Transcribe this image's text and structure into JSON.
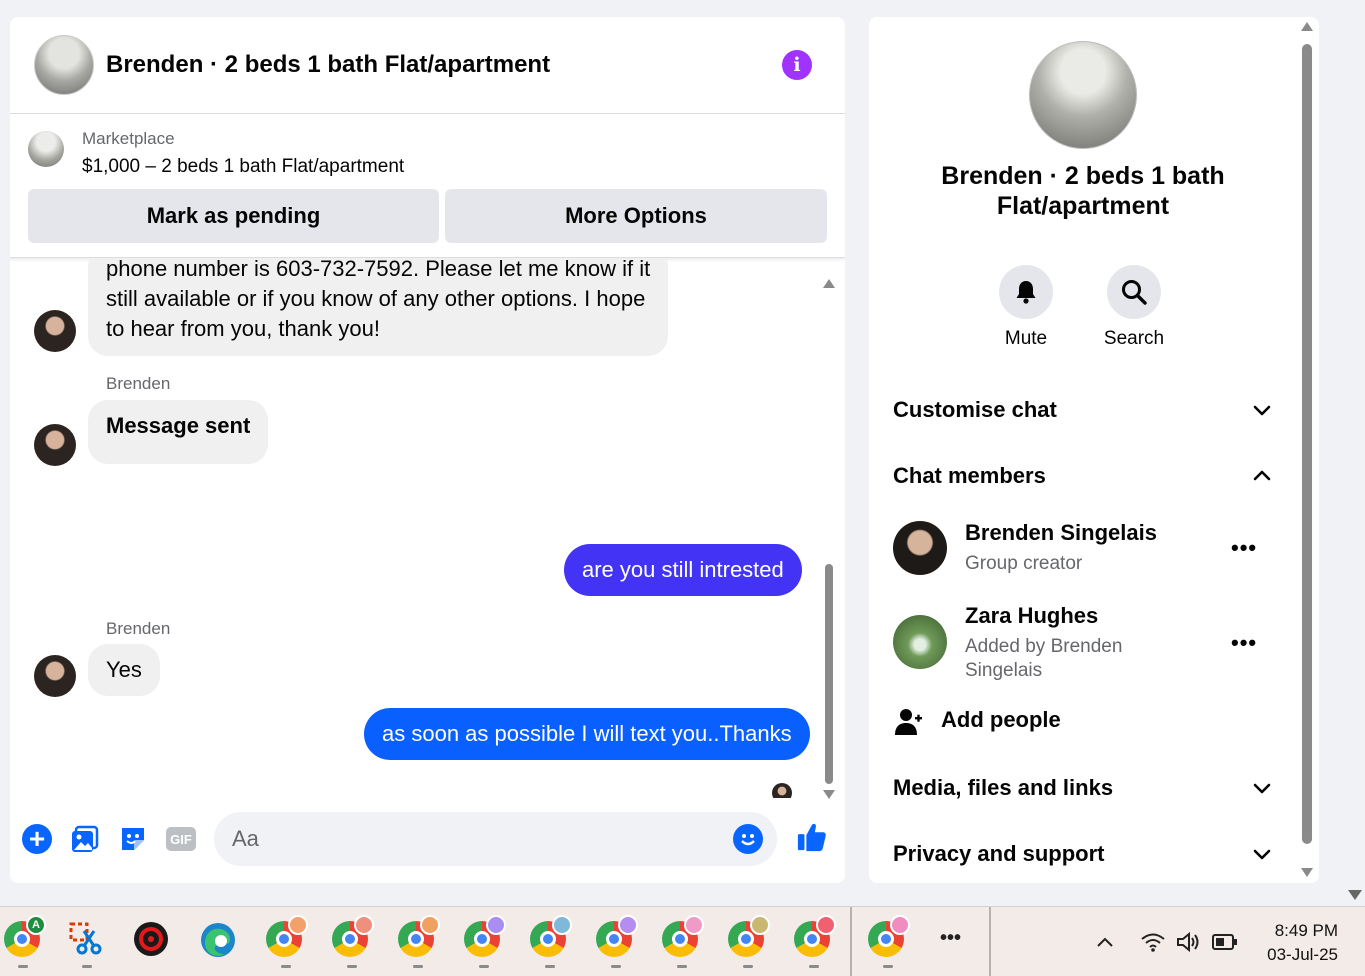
{
  "header": {
    "title": "Brenden · 2 beds 1 bath Flat/apartment"
  },
  "marketplace": {
    "label": "Marketplace",
    "listing": "$1,000 – 2 beds 1 bath Flat/apartment",
    "mark_pending_label": "Mark as pending",
    "more_options_label": "More Options"
  },
  "messages": {
    "partial_message_line1": "phone number is 603-732-7592. Please let me know if it",
    "partial_message_line2": "still available or if you know of any other options. I hope",
    "partial_message_line3": "to hear from you, thank you!",
    "sender_1": "Brenden",
    "message_sent": "Message sent",
    "outgoing_1": "are you still intrested",
    "sender_2": "Brenden",
    "reply_yes": "Yes",
    "outgoing_2": "as soon as possible I will text you..Thanks"
  },
  "composer": {
    "placeholder": "Aa",
    "gif_label": "GIF"
  },
  "info": {
    "title": "Brenden · 2 beds 1 bath Flat/apartment",
    "mute_label": "Mute",
    "search_label": "Search",
    "customise_chat": "Customise chat",
    "chat_members": "Chat members",
    "members": [
      {
        "name": "Brenden Singelais",
        "sub": "Group creator"
      },
      {
        "name": "Zara Hughes",
        "sub": "Added by Brenden Singelais"
      }
    ],
    "more_dots": "•••",
    "add_people": "Add people",
    "media_files_links": "Media, files and links",
    "privacy_support": "Privacy and support"
  },
  "taskbar": {
    "time": "8:49 PM",
    "date": "03-Jul-25",
    "overflow": "•••",
    "first_app_badge": "A"
  },
  "colors": {
    "outgoing_purple": "#4334f5",
    "outgoing_blue": "#0a60ff",
    "accent_blue": "#0866ff",
    "info_purple": "#a033ff"
  }
}
